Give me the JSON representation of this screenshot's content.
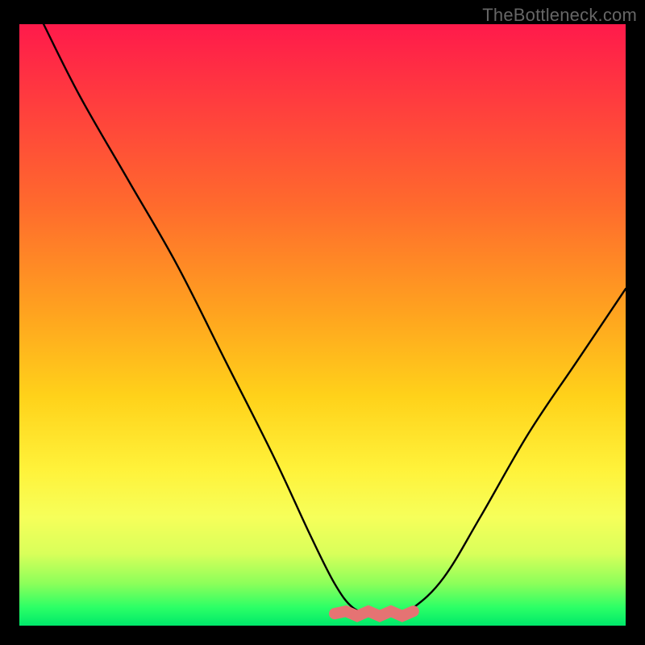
{
  "watermark": {
    "text": "TheBottleneck.com"
  },
  "chart_data": {
    "type": "line",
    "title": "",
    "xlabel": "",
    "ylabel": "",
    "xlim": [
      0,
      100
    ],
    "ylim": [
      0,
      100
    ],
    "grid": false,
    "legend": false,
    "series": [
      {
        "name": "curve",
        "x": [
          4,
          10,
          18,
          26,
          34,
          42,
          48,
          52,
          55,
          58,
          60,
          62,
          65,
          70,
          76,
          84,
          92,
          100
        ],
        "y": [
          100,
          88,
          74,
          60,
          44,
          28,
          15,
          7,
          3,
          2,
          2,
          2,
          3,
          8,
          18,
          32,
          44,
          56
        ]
      }
    ],
    "floor_marker": {
      "name": "sweet-spot",
      "color": "#e57373",
      "x_range": [
        52,
        65
      ],
      "y": 2
    },
    "background_gradient": {
      "top": "#ff1a4b",
      "mid1": "#ffa31f",
      "mid2": "#fff23a",
      "bottom": "#00e86a"
    }
  }
}
